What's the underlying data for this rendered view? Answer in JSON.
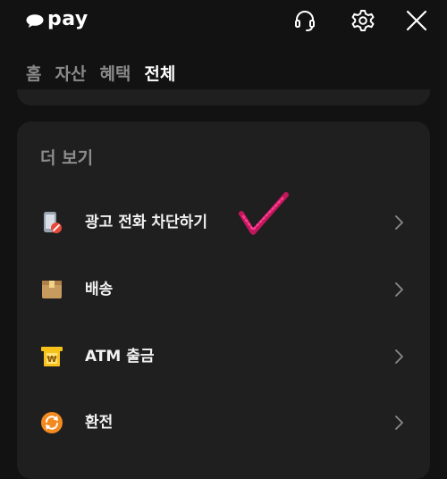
{
  "header": {
    "logo_text": "pay",
    "icons": [
      "headset-icon",
      "gear-icon",
      "close-icon"
    ]
  },
  "tabs": [
    {
      "label": "홈",
      "active": false
    },
    {
      "label": "자산",
      "active": false
    },
    {
      "label": "혜택",
      "active": false
    },
    {
      "label": "전체",
      "active": true
    }
  ],
  "more_section": {
    "title": "더 보기",
    "items": [
      {
        "label": "광고 전화 차단하기",
        "icon": "phone-block-icon"
      },
      {
        "label": "배송",
        "icon": "package-icon"
      },
      {
        "label": "ATM 출금",
        "icon": "atm-icon"
      },
      {
        "label": "환전",
        "icon": "exchange-icon"
      }
    ]
  },
  "colors": {
    "background": "#121212",
    "card": "#1f1f1f",
    "text_primary": "#ffffff",
    "text_muted": "#8a8a8a",
    "atm_yellow": "#f7c21a",
    "exchange_orange": "#f28a1f",
    "package_tan": "#c79a5e",
    "block_red": "#e74a3b"
  }
}
